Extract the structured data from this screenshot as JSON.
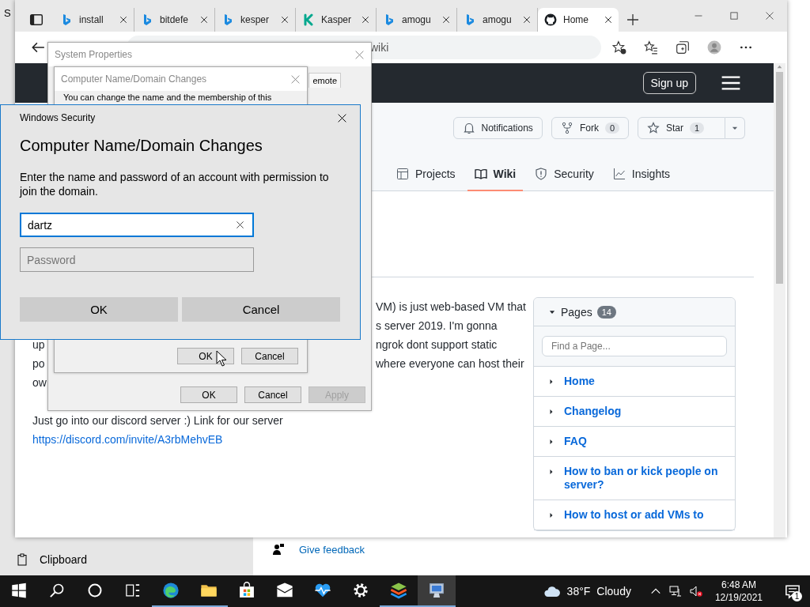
{
  "settings_window": {
    "title": "S",
    "nav_item": {
      "label": "Clipboard"
    },
    "feedback_link": "Give feedback"
  },
  "browser": {
    "tabs": [
      {
        "label": "install",
        "kind": "bing",
        "selected": false
      },
      {
        "label": "bitdefe",
        "kind": "bing",
        "selected": false
      },
      {
        "label": "kesper",
        "kind": "bing",
        "selected": false
      },
      {
        "label": "Kasper",
        "kind": "kaspersky",
        "selected": false
      },
      {
        "label": "amogu",
        "kind": "bing",
        "selected": false
      },
      {
        "label": "amogu",
        "kind": "bing",
        "selected": false
      },
      {
        "label": "Home",
        "kind": "github",
        "selected": true
      }
    ],
    "address_text": "wiki"
  },
  "page": {
    "sign_up": "Sign up",
    "repo_actions": {
      "notifications": "Notifications",
      "fork": "Fork",
      "fork_count": "0",
      "star": "Star",
      "star_count": "1"
    },
    "repo_tabs": [
      {
        "label": "Projects",
        "kind": "projects",
        "selected": false
      },
      {
        "label": "Wiki",
        "kind": "wiki",
        "selected": true
      },
      {
        "label": "Security",
        "kind": "security",
        "selected": false
      },
      {
        "label": "Insights",
        "kind": "insights",
        "selected": false
      }
    ],
    "wiki_lines": [
      {
        "end": "VM) is just web-based VM that"
      },
      {
        "end": "s server 2019. I'm gonna"
      },
      {
        "start": "up",
        "end": "ngrok dont support static"
      },
      {
        "start": "po",
        "end": "where everyone can host their"
      },
      {
        "start": "ow"
      }
    ],
    "wiki_paragraph": "Just go into our discord server :) Link for our server",
    "wiki_link": "https://discord.com/invite/A3rbMehvEB",
    "pages": {
      "title": "Pages",
      "count": "14",
      "expanded": true,
      "search_placeholder": "Find a Page...",
      "items": [
        {
          "label": "Home"
        },
        {
          "label": "Changelog"
        },
        {
          "label": "FAQ"
        },
        {
          "label": "How to ban or kick people on server?"
        },
        {
          "label": "How to host or add VMs to"
        }
      ]
    }
  },
  "system_properties": {
    "title": "System Properties",
    "tab_label": "emote",
    "buttons": [
      {
        "label": "OK",
        "disabled": false
      },
      {
        "label": "Cancel",
        "disabled": false
      },
      {
        "label": "Apply",
        "disabled": true
      }
    ]
  },
  "name_changes": {
    "title": "Computer Name/Domain Changes",
    "text": "You can change the name and the membership of this",
    "buttons": [
      {
        "label": "OK",
        "disabled": false
      },
      {
        "label": "Cancel",
        "disabled": false
      }
    ]
  },
  "windows_security": {
    "title": "Windows Security",
    "heading": "Computer Name/Domain Changes",
    "description": "Enter the name and password of an account with permission to join the domain.",
    "username_value": "dartz",
    "password_placeholder": "Password",
    "buttons": [
      {
        "label": "OK"
      },
      {
        "label": "Cancel"
      }
    ]
  },
  "taskbar": {
    "apps": [
      {
        "kind": "edge",
        "running": true,
        "active": false
      },
      {
        "kind": "folder",
        "running": true,
        "active": false
      },
      {
        "kind": "store",
        "running": false,
        "active": false
      },
      {
        "kind": "mail",
        "running": false,
        "active": false
      },
      {
        "kind": "health",
        "running": false,
        "active": false
      },
      {
        "kind": "settings",
        "running": false,
        "active": false
      },
      {
        "kind": "layers",
        "running": true,
        "active": false
      },
      {
        "kind": "computer",
        "running": true,
        "active": true
      }
    ],
    "weather": {
      "temperature": "38°F",
      "condition": "Cloudy"
    },
    "time": "6:48 AM",
    "date": "12/19/2021",
    "notification_count": "1"
  }
}
